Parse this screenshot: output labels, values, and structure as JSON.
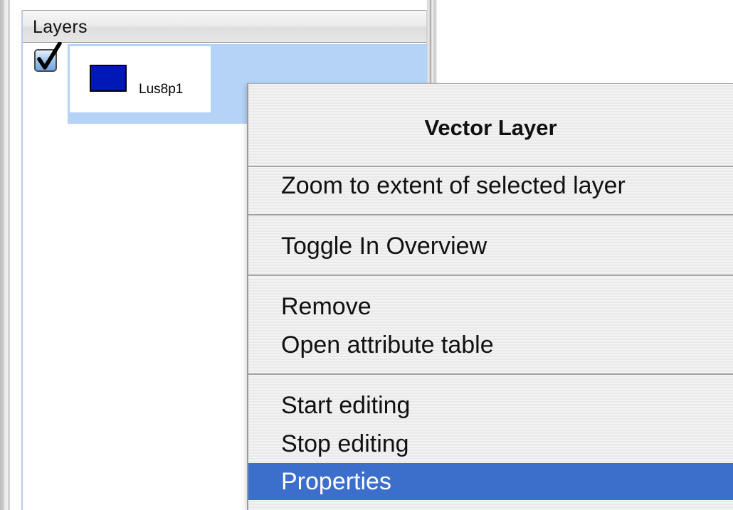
{
  "layers_panel": {
    "title": "Layers",
    "layers": [
      {
        "name": "Lus8p1",
        "visible": true,
        "selected": true,
        "swatch_color": "#0018b8"
      }
    ]
  },
  "context_menu": {
    "title": "Vector Layer",
    "items": [
      {
        "label": "Zoom to extent of selected layer",
        "highlighted": false
      },
      {
        "label": "Toggle In Overview",
        "highlighted": false
      },
      {
        "label": "Remove",
        "highlighted": false
      },
      {
        "label": "Open attribute table",
        "highlighted": false
      },
      {
        "label": "Start editing",
        "highlighted": false
      },
      {
        "label": "Stop editing",
        "highlighted": false
      },
      {
        "label": "Properties",
        "highlighted": true
      }
    ]
  },
  "colors": {
    "selection_background": "#b5d2f7",
    "menu_highlight": "#3c6ecb",
    "layer_fill": "#0018b8"
  },
  "icons": {
    "checkbox": "checkbox-checked-icon",
    "swatch": "layer-color-swatch"
  }
}
